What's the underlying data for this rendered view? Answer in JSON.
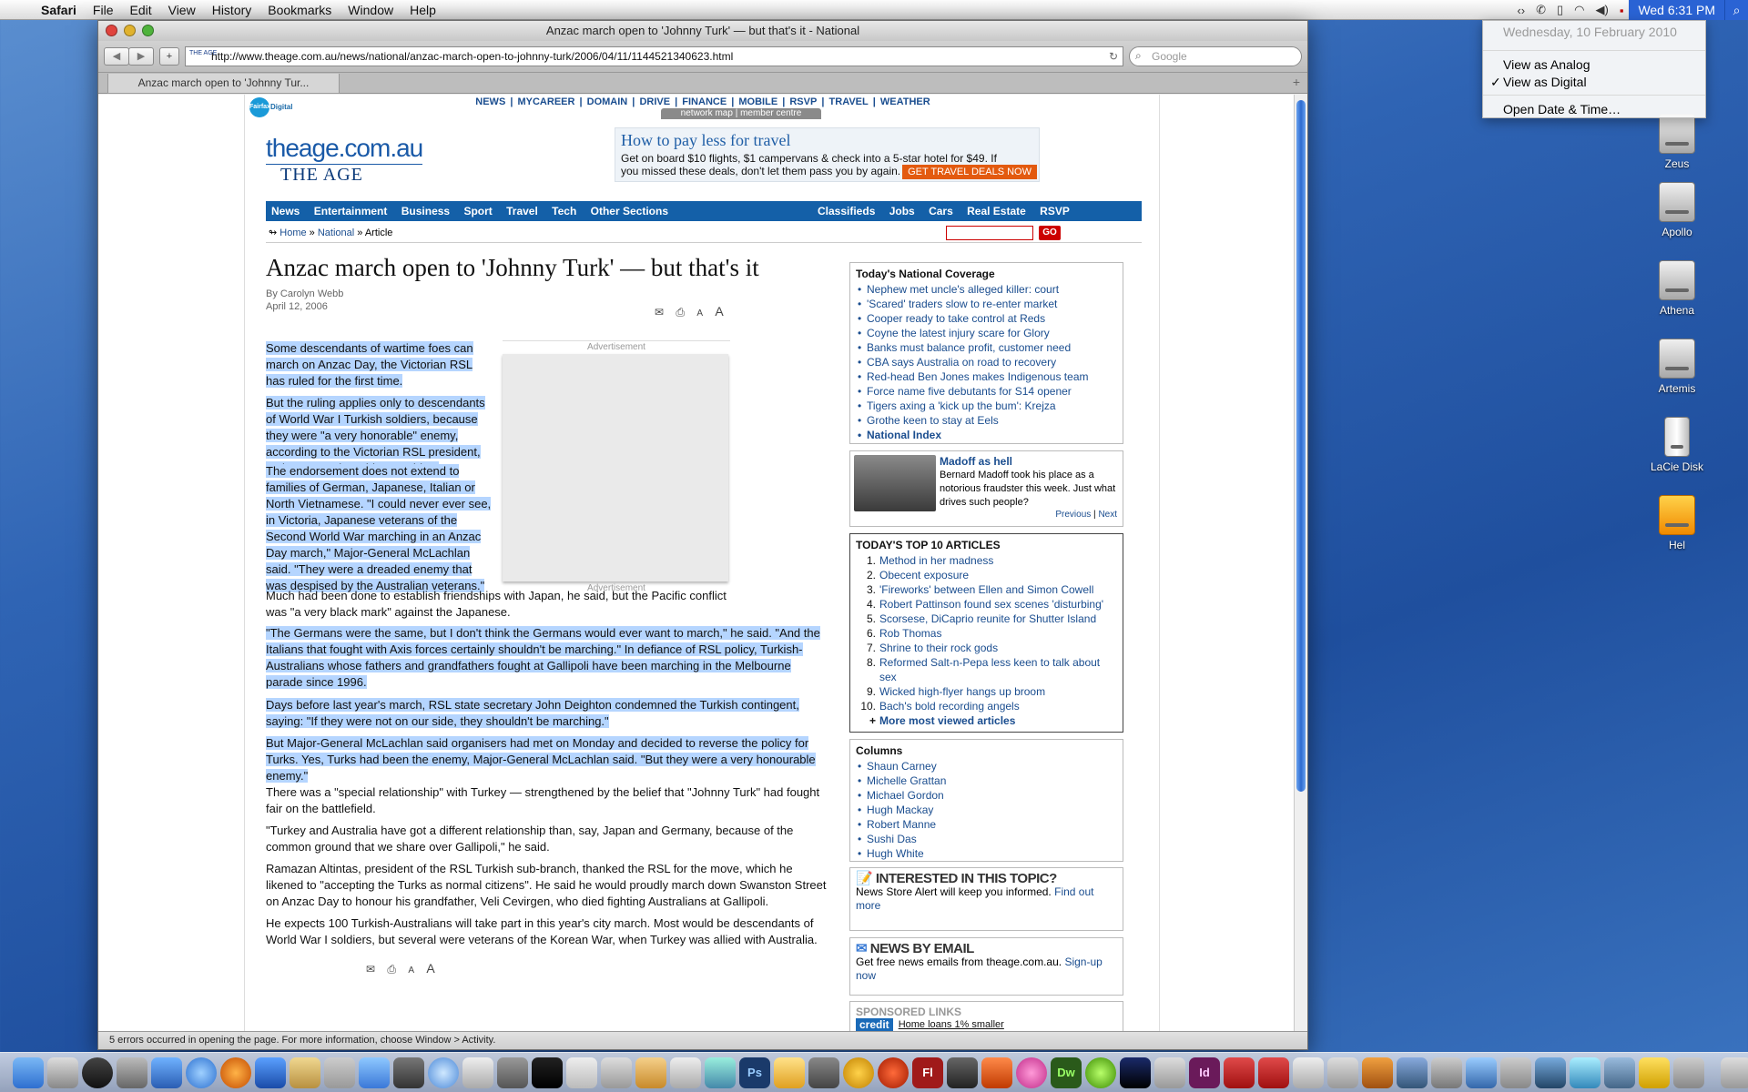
{
  "menubar": {
    "app": "Safari",
    "items": [
      "File",
      "Edit",
      "View",
      "History",
      "Bookmarks",
      "Window",
      "Help"
    ],
    "clock": "Wed 6:31 PM"
  },
  "clock_menu": {
    "date": "Wednesday, 10 February 2010",
    "items": [
      "View as Analog",
      "View as Digital",
      "Open Date & Time…"
    ],
    "checked_index": 1
  },
  "desktop": {
    "icons": [
      "Zeus",
      "Apollo",
      "Athena",
      "Artemis",
      "LaCie Disk",
      "Hel"
    ]
  },
  "window": {
    "title": "Anzac march open to 'Johnny Turk' — but that's it - National",
    "url": "http://www.theage.com.au/news/national/anzac-march-open-to-johnny-turk/2006/04/11/1144521340623.html",
    "search_placeholder": "Google",
    "tab_label": "Anzac march open to 'Johnny Tur...",
    "status": "5 errors occurred in opening the page. For more information, choose Window > Activity."
  },
  "site": {
    "network_links": [
      "NEWS",
      "MYCAREER",
      "DOMAIN",
      "DRIVE",
      "FINANCE",
      "MOBILE",
      "RSVP",
      "TRAVEL",
      "WEATHER"
    ],
    "network_map": "network map | member centre",
    "fairfax": "Fairfax",
    "fairfax_digital": "Digital",
    "logo_top": "theage.com.au",
    "logo_bottom": "THE AGE",
    "ad_title": "How to pay less for travel",
    "ad_body": "Get on board $10 flights, $1 campervans & check into a 5-star hotel for $49.  If you missed these deals, don't let them pass you by again.",
    "ad_cta": "GET TRAVEL DEALS NOW",
    "main_nav_left": [
      "News",
      "Entertainment",
      "Business",
      "Sport",
      "Travel",
      "Tech",
      "Other Sections"
    ],
    "main_nav_right": [
      "Classifieds",
      "Jobs",
      "Cars",
      "Real Estate",
      "RSVP"
    ],
    "breadcrumb": {
      "home": "Home",
      "section": "National",
      "current": "Article"
    },
    "go_label": "GO"
  },
  "article": {
    "headline": "Anzac march open to 'Johnny Turk' — but that's it",
    "author": "By Carolyn Webb",
    "date": "April 12, 2006",
    "advertisement_label": "Advertisement",
    "paragraphs": [
      "Some descendants of wartime foes can march on Anzac Day, the Victorian RSL has ruled for the first time.",
      "But the ruling applies only to descendants of World War I Turkish soldiers, because they were \"a very honorable\" enemy, according to the Victorian RSL president, Major-General David McLachlan.",
      "The endorsement does not extend to families of German, Japanese, Italian or North Vietnamese. \"I could never ever see, in Victoria, Japanese veterans of the Second World War marching in an Anzac Day march,\" Major-General McLachlan said. \"They were a dreaded enemy that was despised by the Australian veterans.\"",
      "Much had been done to establish friendships with Japan, he said, but the Pacific conflict was \"a very black mark\" against the Japanese.",
      "\"The Germans were the same, but I don't think the Germans would ever want to march,\" he said. \"And the Italians that fought with Axis forces certainly shouldn't be marching.\" In defiance of RSL policy, Turkish-Australians whose fathers and grandfathers fought at Gallipoli have been marching in the Melbourne parade since 1996.",
      "Days before last year's march, RSL state secretary John Deighton condemned the Turkish contingent, saying: \"If they were not on our side, they shouldn't be marching.\"",
      "But Major-General McLachlan said organisers had met on Monday and decided to reverse the policy for Turks. Yes, Turks had been the enemy, Major-General McLachlan said. \"But they were a very honourable enemy.\"",
      "There was a \"special relationship\" with Turkey — strengthened by the belief that \"Johnny Turk\" had fought fair on the battlefield.",
      "\"Turkey and Australia have got a different relationship than, say, Japan and Germany, because of the common ground that we share over Gallipoli,\" he said.",
      "Ramazan Altintas, president of the RSL Turkish sub-branch, thanked the RSL for the move, which he likened to \"accepting the Turks as normal citizens\". He said he would proudly march down Swanston Street on Anzac Day to honour his grandfather, Veli Cevirgen, who died fighting Australians at Gallipoli.",
      "He expects 100 Turkish-Australians will take part in this year's city march. Most would be descendants of World War I soldiers, but several were veterans of the Korean War, when Turkey was allied with Australia."
    ]
  },
  "sidebar": {
    "national_title": "Today's National Coverage",
    "national_items": [
      "Nephew met uncle's alleged killer: court",
      "'Scared' traders slow to re-enter market",
      "Cooper ready to take control at Reds",
      "Coyne the latest injury scare for Glory",
      "Banks must balance profit, customer need",
      "CBA says Australia on road to recovery",
      "Red-head Ben Jones makes Indigenous team",
      "Force name five debutants for S14 opener",
      "Tigers axing a 'kick up the bum': Krejza",
      "Grothe keen to stay at Eels"
    ],
    "national_index": "National Index",
    "feature_title": "Madoff as hell",
    "feature_body": "Bernard Madoff took his place as a notorious fraudster this week. Just what drives such people?",
    "feature_prev": "Previous",
    "feature_next": "Next",
    "top10_title": "TODAY'S TOP 10 ARTICLES",
    "top10": [
      "Method in her madness",
      "Obecent exposure",
      "'Fireworks' between Ellen and Simon Cowell",
      "Robert Pattinson found sex scenes 'disturbing'",
      "Scorsese, DiCaprio reunite for Shutter Island",
      "Rob Thomas",
      "Shrine to their rock gods",
      "Reformed Salt-n-Pepa less keen to talk about sex",
      "Wicked high-flyer hangs up broom",
      "Bach's bold recording angels"
    ],
    "top10_more": "More most viewed articles",
    "columns_title": "Columns",
    "columns": [
      "Shaun Carney",
      "Michelle Grattan",
      "Michael Gordon",
      "Hugh Mackay",
      "Robert Manne",
      "Sushi Das",
      "Hugh White"
    ],
    "interested_title": "INTERESTED IN THIS TOPIC?",
    "interested_body": "News Store Alert will keep you informed.",
    "interested_link": "Find out more",
    "email_title": "NEWS BY EMAIL",
    "email_body": "Get free news emails from theage.com.au.",
    "email_link": "Sign-up now",
    "sponsored_title": "SPONSORED LINKS",
    "sponsored_item": "Home loans 1% smaller"
  }
}
